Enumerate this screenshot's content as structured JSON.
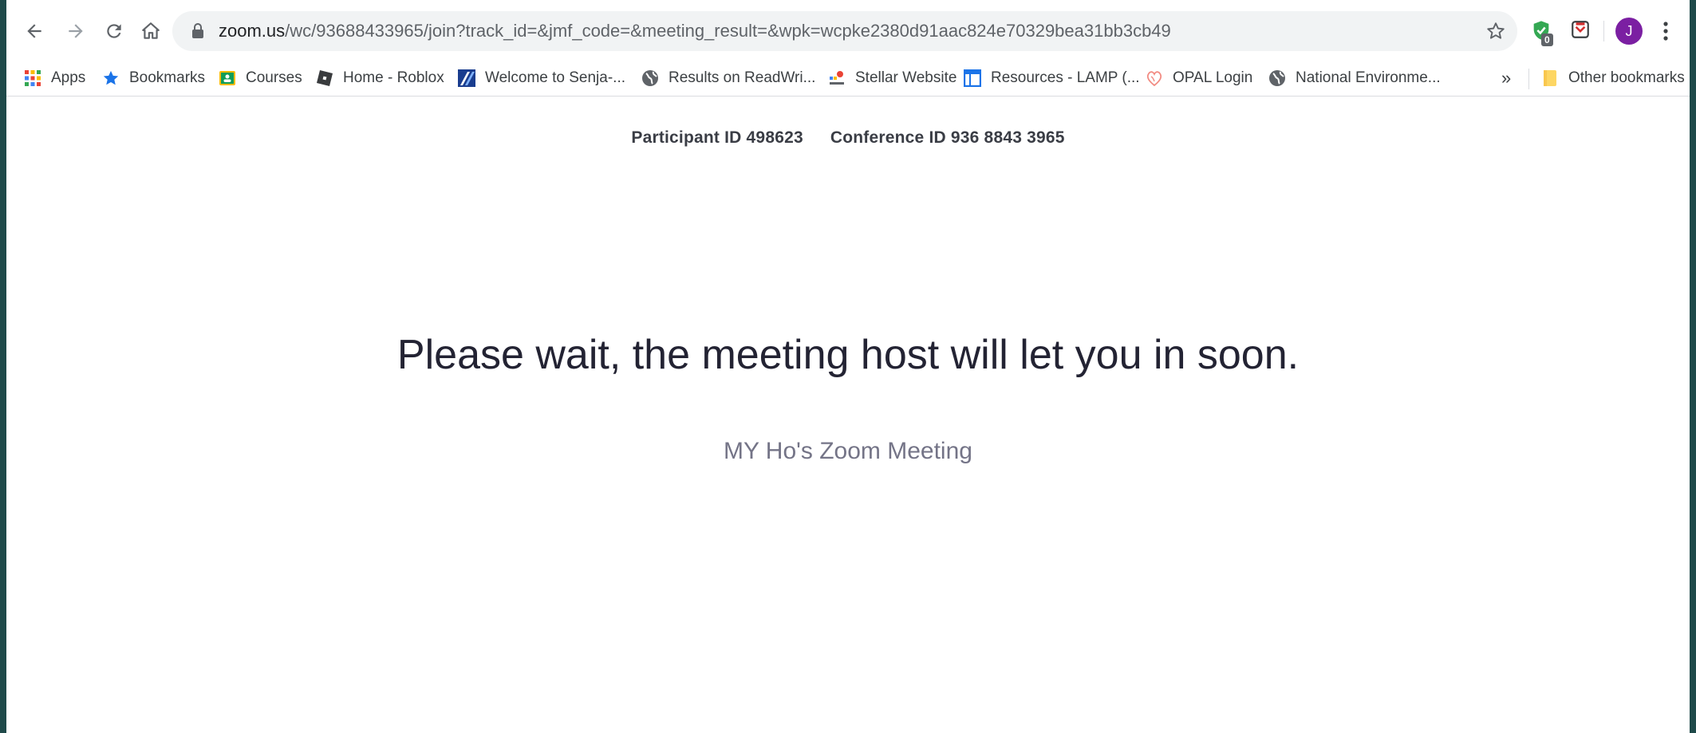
{
  "browser": {
    "url_host": "zoom.us",
    "url_path": "/wc/93688433965/join?track_id=&jmf_code=&meeting_result=&wpk=wcpke2380d91aac824e70329bea31bb3cb49",
    "extension_badge": "0",
    "profile_initial": "J"
  },
  "bookmarks": {
    "items": [
      {
        "label": "Apps",
        "icon": "apps-grid-icon"
      },
      {
        "label": "Bookmarks",
        "icon": "star-icon"
      },
      {
        "label": "Courses",
        "icon": "classroom-icon"
      },
      {
        "label": "Home - Roblox",
        "icon": "roblox-icon"
      },
      {
        "label": "Welcome to Senja-...",
        "icon": "senja-icon"
      },
      {
        "label": "Results on ReadWri...",
        "icon": "globe-icon"
      },
      {
        "label": "Stellar Website",
        "icon": "stellar-icon"
      },
      {
        "label": "Resources - LAMP (...",
        "icon": "lamp-icon"
      },
      {
        "label": "OPAL Login",
        "icon": "opal-icon"
      },
      {
        "label": "National Environme...",
        "icon": "globe-icon"
      }
    ],
    "overflow": "»",
    "other_label": "Other bookmarks"
  },
  "page": {
    "participant_id": "Participant ID 498623",
    "conference_id": "Conference ID 936 8843 3965",
    "wait_message": "Please wait, the meeting host will let you in soon.",
    "meeting_name": "MY Ho's Zoom Meeting"
  },
  "colors": {
    "background_frame": "#1f4a4a",
    "avatar": "#7b1fa2",
    "title_text": "#232333",
    "subtitle_text": "#747487"
  }
}
